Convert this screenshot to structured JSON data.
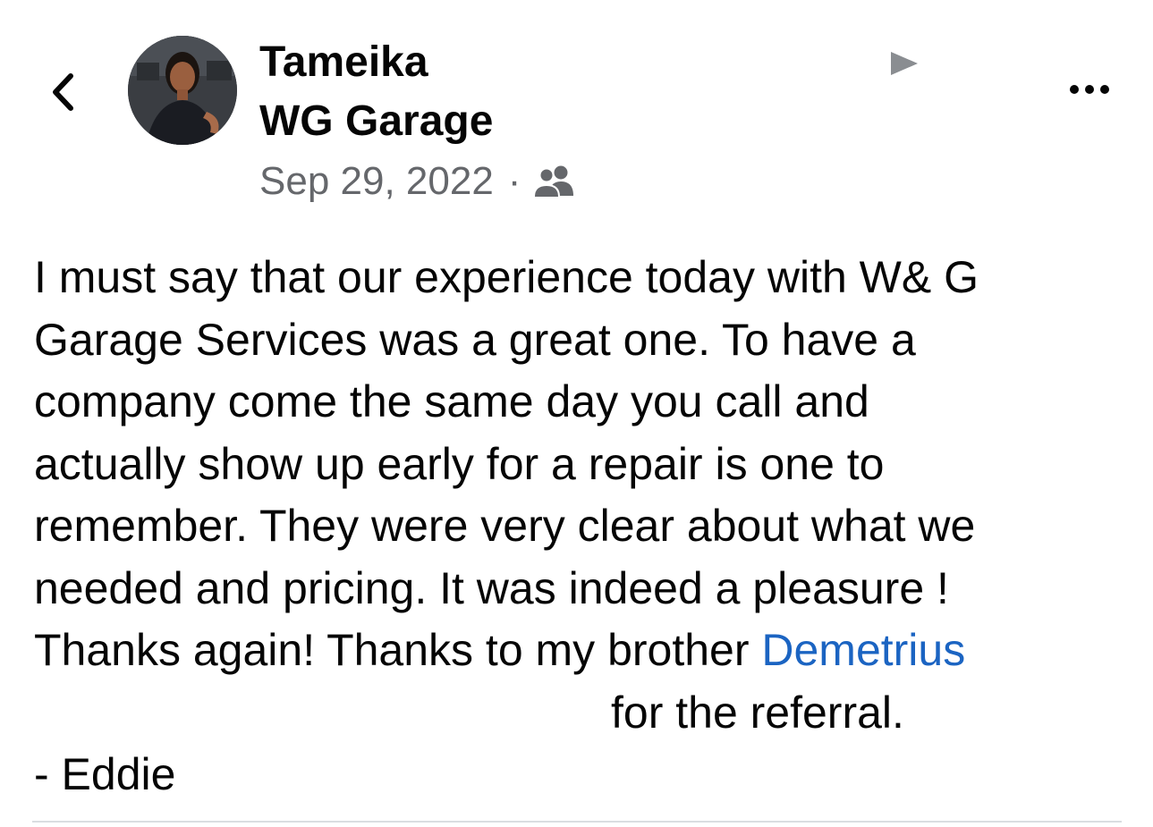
{
  "header": {
    "author_name": "Tameika",
    "group_name": "WG Garage",
    "date": "Sep 29, 2022",
    "separator": "·",
    "privacy_icon": "group-members-icon",
    "back_icon": "chevron-left-icon",
    "more_icon": "more-dots-icon",
    "play_icon": "play-triangle-icon"
  },
  "post": {
    "lines": [
      "I must say that our experience today with W& G",
      "Garage Services was a great one. To have a",
      "company come the same day you call and",
      "actually show up early for a repair is one to",
      "remember. They were very clear about what we",
      "needed and pricing. It was indeed a pleasure !"
    ],
    "thanks_prefix": "Thanks again! Thanks to my brother ",
    "mention": "Demetrius",
    "thanks_suffix": "for the referral.",
    "signature": "- Eddie"
  },
  "colors": {
    "text": "#050505",
    "secondary_text": "#65676b",
    "mention": "#1b64c2",
    "divider": "#dadde1"
  }
}
